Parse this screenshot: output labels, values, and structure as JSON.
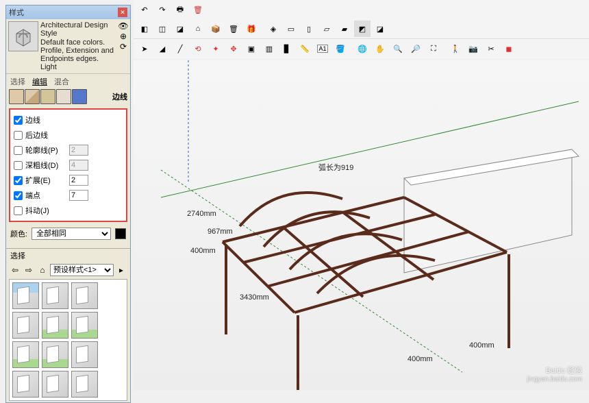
{
  "panel": {
    "title": "样式",
    "style_name": "Architectural Design Style",
    "style_desc": "Default face colors. Profile, Extension and Endpoints edges. Light",
    "tabs": {
      "select": "选择",
      "edit": "编辑",
      "mix": "混合"
    },
    "section_label": "边线",
    "edges": {
      "edge": {
        "label": "边线",
        "checked": true
      },
      "back": {
        "label": "后边线",
        "checked": false
      },
      "profile": {
        "label": "轮廓线(P)",
        "checked": false,
        "value": "2"
      },
      "depth": {
        "label": "深粗线(D)",
        "checked": false,
        "value": "4"
      },
      "extend": {
        "label": "扩展(E)",
        "checked": true,
        "value": "2"
      },
      "endpoint": {
        "label": "端点",
        "checked": true,
        "value": "7"
      },
      "jitter": {
        "label": "抖动(J)",
        "checked": false
      }
    },
    "color": {
      "label": "颜色:",
      "value": "全部相同"
    }
  },
  "select": {
    "title": "选择",
    "combo": "预设样式<1>"
  },
  "viewport": {
    "arc_label": "弧长为919",
    "dims": {
      "d400a": "400mm",
      "d967": "967mm",
      "d2740": "2740mm",
      "d3430": "3430mm",
      "d400b": "400mm",
      "d400c": "400mm"
    }
  },
  "watermark": {
    "brand": "Baidu 经验",
    "url": "jingyan.baidu.com"
  }
}
